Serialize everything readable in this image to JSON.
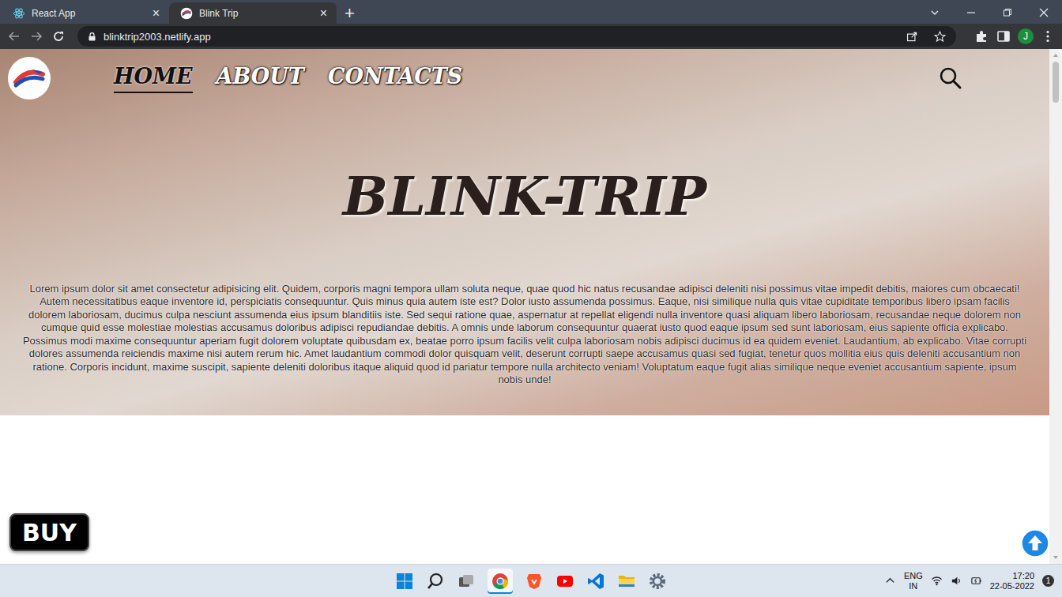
{
  "browser": {
    "tabs": [
      {
        "label": "React App",
        "selected": false,
        "kind": "react",
        "close": "×"
      },
      {
        "label": "Blink Trip",
        "selected": true,
        "kind": "site",
        "close": "×"
      }
    ],
    "new_tab": "+",
    "address": "blinktrip2003.netlify.app",
    "profile": "J"
  },
  "page": {
    "nav": [
      {
        "label": "HOME",
        "selected": true
      },
      {
        "label": "ABOUT",
        "selected": false
      },
      {
        "label": "CONTACTS",
        "selected": false
      }
    ],
    "title": "BLINK-TRIP",
    "paragraph": "Lorem ipsum dolor sit amet consectetur adipisicing elit. Quidem, corporis magni tempora ullam soluta neque, quae quod hic natus recusandae adipisci deleniti nisi possimus vitae impedit debitis, maiores cum obcaecati! Autem necessitatibus eaque inventore id, perspiciatis consequuntur. Quis minus quia autem iste est? Dolor iusto assumenda possimus. Eaque, nisi similique nulla quis vitae cupiditate temporibus libero ipsam facilis dolorem laboriosam, ducimus culpa nesciunt assumenda eius ipsum blanditiis iste. Sed sequi ratione quae, aspernatur at repellat eligendi nulla inventore quasi aliquam libero laboriosam, recusandae neque dolorem non cumque quid esse molestiae molestias accusamus doloribus adipisci repudiandae debitis. A omnis unde laborum consequuntur quaerat iusto quod eaque ipsum sed sunt laboriosam, eius sapiente officia explicabo. Possimus modi maxime consequuntur aperiam fugit dolorem voluptate quibusdam ex, beatae porro ipsum facilis velit culpa laboriosam nobis adipisci ducimus id ea quidem eveniet. Laudantium, ab explicabo. Vitae corrupti dolores assumenda reiciendis maxime nisi autem rerum hic. Amet laudantium commodi dolor quisquam velit, deserunt corrupti saepe accusamus quasi sed fugiat, tenetur quos mollitia eius quis deleniti accusantium non ratione. Corporis incidunt, maxime suscipit, sapiente deleniti doloribus itaque aliquid quod id pariatur tempore nulla architecto veniam! Voluptatum eaque fugit alias similique neque eveniet accusantium sapiente, ipsum nobis unde!",
    "buy_button": "BUY"
  },
  "taskbar": {
    "language": "ENG",
    "region": "IN",
    "time": "17:20",
    "date": "22-05-2022",
    "notifications": "1"
  }
}
